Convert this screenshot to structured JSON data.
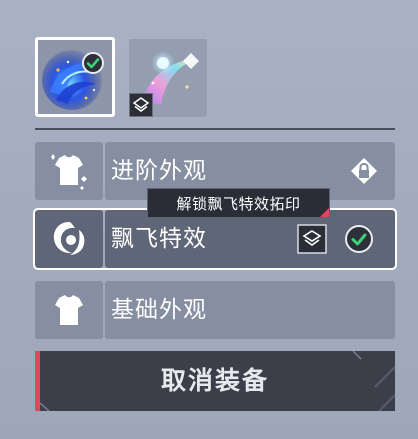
{
  "colors": {
    "accent_red": "#e0485d",
    "panel_bg": "#a9b2c3",
    "row_bg": "#868fa2",
    "row_selected_bg": "#5f6677",
    "equip_button_bg": "#3c3f4a",
    "check_green": "#3dd07a"
  },
  "thumbnails": [
    {
      "icon": "blue-flying-effect-icon",
      "selected": true,
      "badge": "check-icon"
    },
    {
      "icon": "rainbow-flying-effect-icon",
      "selected": false,
      "badge": "layers-icon"
    }
  ],
  "rows": {
    "advanced": {
      "label": "进阶外观",
      "icon": "shirt-sparkle-icon",
      "right_icon": "locked-diamond-icon"
    },
    "flying": {
      "label": "飘飞特效",
      "icon": "swirl-icon",
      "right_icons": [
        "layers-icon",
        "check-circle-icon"
      ],
      "selected": true
    },
    "basic": {
      "label": "基础外观",
      "icon": "shirt-icon"
    }
  },
  "tooltip": {
    "text": "解锁飘飞特效拓印"
  },
  "unequip_button": {
    "label": "取消装备"
  }
}
